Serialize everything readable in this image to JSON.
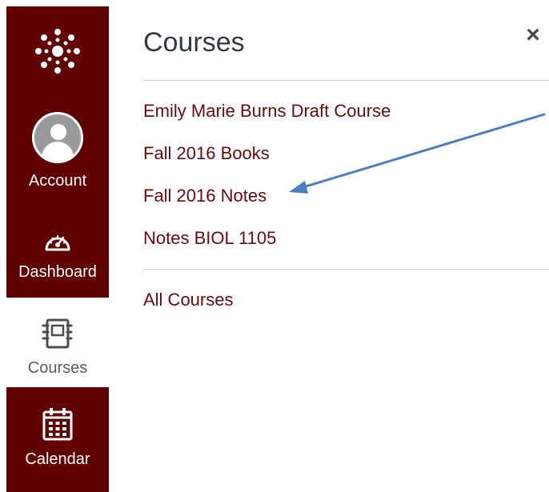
{
  "global_nav": {
    "account_label": "Account",
    "dashboard_label": "Dashboard",
    "courses_label": "Courses",
    "calendar_label": "Calendar",
    "brand_color": "#600000"
  },
  "tray": {
    "title": "Courses",
    "close_label": "×",
    "courses": [
      {
        "name": "Emily Marie Burns Draft Course"
      },
      {
        "name": "Fall 2016 Books"
      },
      {
        "name": "Fall 2016 Notes"
      },
      {
        "name": "Notes BIOL 1105"
      }
    ],
    "all_courses_label": "All Courses",
    "link_color": "#6b0a0a"
  },
  "annotation": {
    "type": "arrow",
    "color": "#4a7fc1",
    "points_to": "Fall 2016 Notes"
  }
}
